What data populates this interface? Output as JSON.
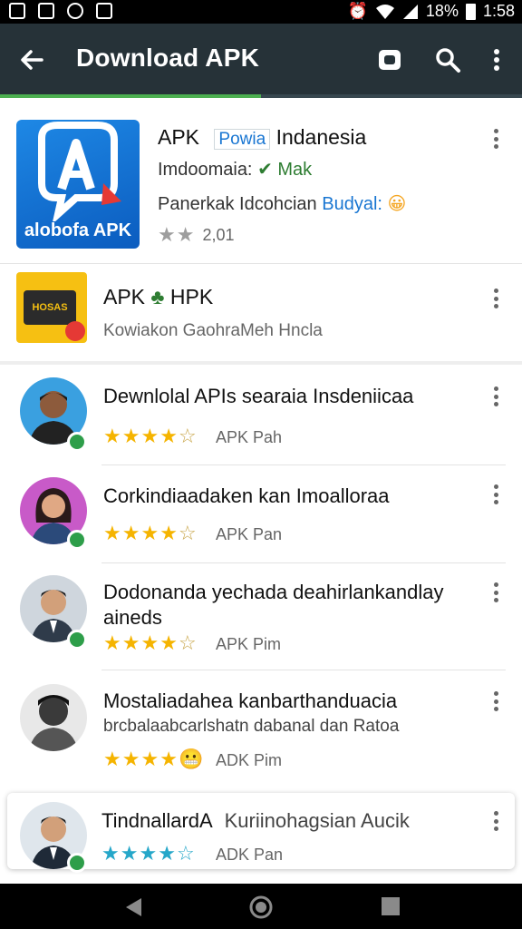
{
  "status": {
    "battery": "18%",
    "time": "1:58"
  },
  "appbar": {
    "title": "Download APK",
    "progress": 0.5
  },
  "featured": [
    {
      "title": "APK",
      "badge": "Powia",
      "title_rest": "Indanesia",
      "line2_prefix": "Imdoomaia:",
      "line2_tag": "Mak",
      "line3": "Panerkak Idcohcian",
      "line3_accent": "Budyal:",
      "rating_text": "2,01",
      "icon_caption": "alobofa APK",
      "stars": 2
    },
    {
      "title": "APK",
      "title_rest": "HPK",
      "subtitle": "Kowiakon GaohraMeh Hncla",
      "icon_label": "HOSAS"
    }
  ],
  "reviews": [
    {
      "title": "Dewnlolal APIs searaia Insdeniicaa",
      "meta": "APK Pah",
      "stars": 4
    },
    {
      "title": "Corkindiaadaken kan Imoalloraa",
      "meta": "APK Pan",
      "stars": 4
    },
    {
      "title": "Dodonanda yechada deahirlankandlay",
      "title2": "aineds",
      "meta": "APK Pim",
      "stars": 4
    },
    {
      "title": "Mostaliadahea kanbarthanduacia",
      "subtitle": "brcbalaabcarlshatn dabanal dan Ratoa",
      "meta": "ADK Pim",
      "stars": 4
    },
    {
      "title": "TindnallardA",
      "title_rest": "Kuriinohagsian Aucik",
      "meta": "ADK Pan",
      "stars": 4
    }
  ],
  "colors": {
    "appbar": "#263238",
    "accent_green": "#4caf50",
    "star": "#f5b400",
    "link_blue": "#1976d2"
  }
}
